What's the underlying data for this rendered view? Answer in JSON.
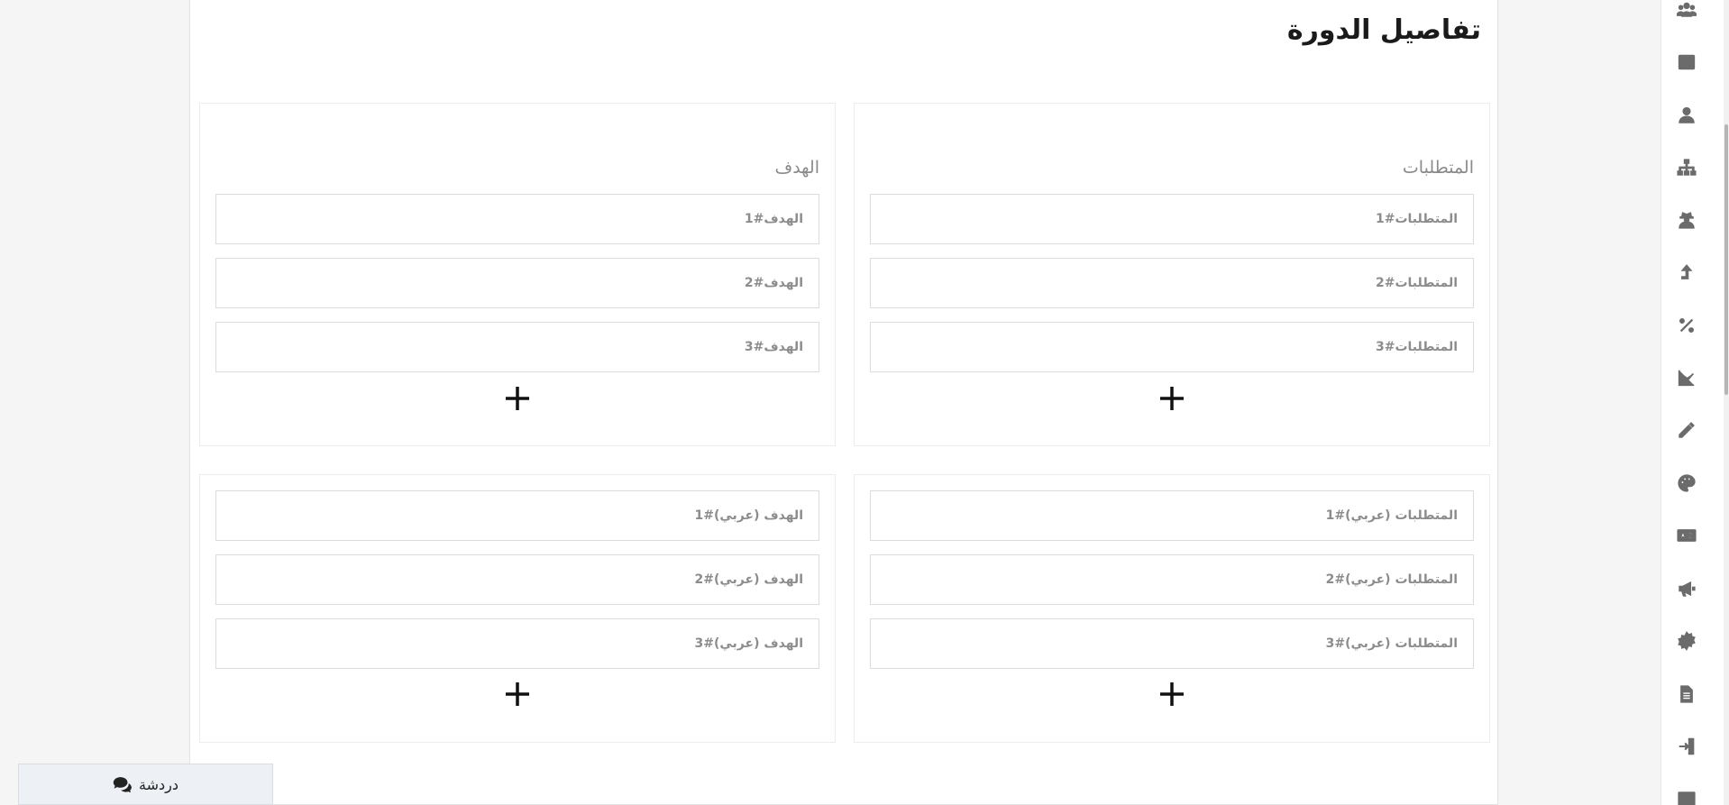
{
  "page_title": "تفاصيل الدورة",
  "requirements": {
    "label": "المتطلبات",
    "fields": [
      "المتطلبات#1",
      "المتطلبات#2",
      "المتطلبات#3"
    ]
  },
  "objectives": {
    "label": "الهدف",
    "fields": [
      "الهدف#1",
      "الهدف#2",
      "الهدف#3"
    ]
  },
  "requirements_ar": {
    "fields": [
      "المتطلبات (عربي)#1",
      "المتطلبات (عربي)#2",
      "المتطلبات (عربي)#3"
    ]
  },
  "objectives_ar": {
    "fields": [
      "الهدف (عربي)#1",
      "الهدف (عربي)#2",
      "الهدف (عربي)#3"
    ]
  },
  "chat": {
    "label": "دردشة"
  },
  "sidebar_icons": [
    "users-icon",
    "table-icon",
    "user-tie-icon",
    "sitemap-icon",
    "user-secret-icon",
    "level-up-icon",
    "percent-icon",
    "chart-line-icon",
    "pencil-icon",
    "palette-icon",
    "language-icon",
    "bullhorn-icon",
    "certificate-icon",
    "file-icon",
    "sign-in-icon",
    "id-card-icon"
  ],
  "colors": {
    "accent": "#1a1a1a",
    "muted": "#8a8a8a",
    "chat_bg": "#edf1f5"
  }
}
